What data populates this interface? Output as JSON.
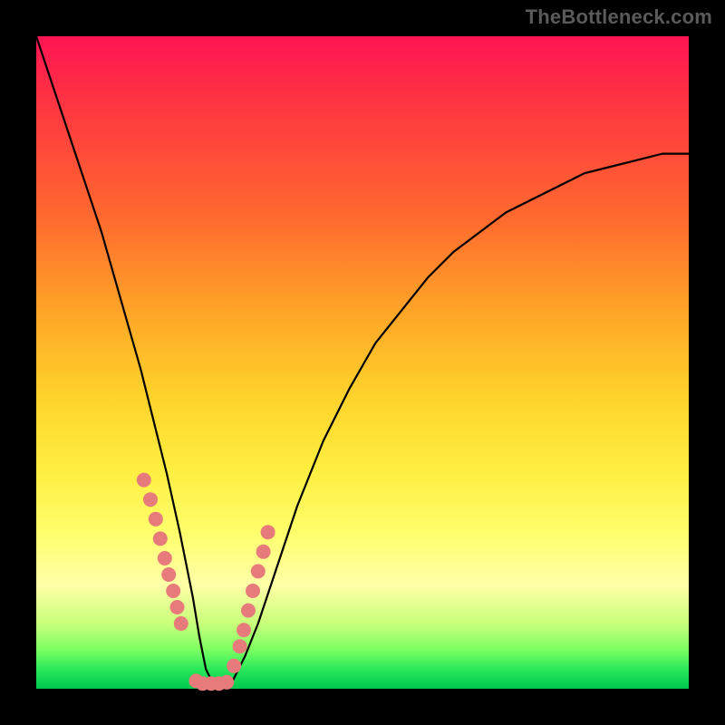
{
  "watermark": "TheBottleneck.com",
  "chart_data": {
    "type": "line",
    "title": "",
    "xlabel": "",
    "ylabel": "",
    "xlim": [
      0,
      100
    ],
    "ylim": [
      0,
      100
    ],
    "grid": false,
    "legend": false,
    "background_gradient": {
      "direction": "vertical",
      "stops": [
        {
          "pos": 0.0,
          "color": "#ff1452"
        },
        {
          "pos": 0.12,
          "color": "#ff3a3f"
        },
        {
          "pos": 0.28,
          "color": "#ff6a2f"
        },
        {
          "pos": 0.42,
          "color": "#ffa427"
        },
        {
          "pos": 0.55,
          "color": "#ffd22a"
        },
        {
          "pos": 0.66,
          "color": "#ffed3f"
        },
        {
          "pos": 0.76,
          "color": "#fffe6b"
        },
        {
          "pos": 0.84,
          "color": "#ffffa8"
        },
        {
          "pos": 0.9,
          "color": "#c9ff7a"
        },
        {
          "pos": 0.94,
          "color": "#7dff62"
        },
        {
          "pos": 0.97,
          "color": "#29e85a"
        },
        {
          "pos": 1.0,
          "color": "#00c84f"
        }
      ]
    },
    "series": [
      {
        "name": "bottleneck-curve",
        "x": [
          0,
          2,
          4,
          6,
          8,
          10,
          12,
          14,
          16,
          18,
          20,
          22,
          24,
          25,
          26,
          27,
          28,
          29,
          30,
          32,
          34,
          36,
          38,
          40,
          44,
          48,
          52,
          56,
          60,
          64,
          68,
          72,
          76,
          80,
          84,
          88,
          92,
          96,
          100
        ],
        "y": [
          100,
          94,
          88,
          82,
          76,
          70,
          63,
          56,
          49,
          41,
          33,
          24,
          14,
          8,
          3,
          1,
          0,
          0,
          1,
          5,
          10,
          16,
          22,
          28,
          38,
          46,
          53,
          58,
          63,
          67,
          70,
          73,
          75,
          77,
          79,
          80,
          81,
          82,
          82
        ]
      },
      {
        "name": "markers",
        "type": "scatter",
        "color": "#E77B7B",
        "x": [
          16.5,
          17.5,
          18.3,
          19.0,
          19.7,
          20.3,
          21.0,
          21.6,
          22.2,
          24.5,
          25.5,
          26.8,
          28.0,
          29.2,
          30.3,
          31.2,
          31.8,
          32.5,
          33.2,
          34.0,
          34.8,
          35.5
        ],
        "y": [
          32.0,
          29.0,
          26.0,
          23.0,
          20.0,
          17.5,
          15.0,
          12.5,
          10.0,
          1.2,
          0.8,
          0.8,
          0.8,
          1.0,
          3.5,
          6.5,
          9.0,
          12.0,
          15.0,
          18.0,
          21.0,
          24.0
        ]
      }
    ]
  }
}
